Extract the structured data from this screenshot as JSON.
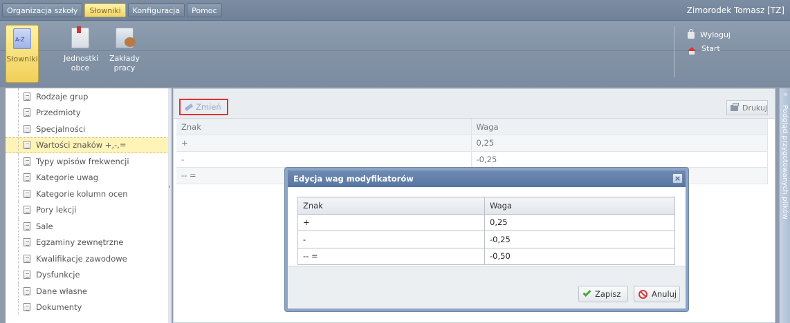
{
  "menu": {
    "items": [
      {
        "label": "Organizacja szkoły",
        "active": false
      },
      {
        "label": "Słowniki",
        "active": true
      },
      {
        "label": "Konfiguracja",
        "active": false
      },
      {
        "label": "Pomoc",
        "active": false
      }
    ],
    "user": "Zimorodek Tomasz [TZ]"
  },
  "ribbon": {
    "buttons": [
      {
        "label": "Słowniki",
        "icon": "dictionary-icon",
        "active": true
      },
      {
        "label": "Jednostki obce",
        "icon": "document-icon",
        "active": false
      },
      {
        "label": "Zakłady pracy",
        "icon": "briefcase-icon",
        "active": false
      }
    ],
    "logout": "Wyloguj",
    "start": "Start"
  },
  "sidebar": {
    "items": [
      "Rodzaje grup",
      "Przedmioty",
      "Specjalności",
      "Wartości znaków +,-,=",
      "Typy wpisów frekwencji",
      "Kategorie uwag",
      "Kategorie kolumn ocen",
      "Pory lekcji",
      "Sale",
      "Egzaminy zewnętrzne",
      "Kwalifikacje zawodowe",
      "Dysfunkcje",
      "Dane własne",
      "Dokumenty"
    ],
    "selected_index": 3
  },
  "main": {
    "toolbar": {
      "edit_label": "Zmień",
      "print_label": "Drukuj"
    },
    "columns": [
      "Znak",
      "Waga"
    ],
    "rows": [
      [
        "+",
        "0,25"
      ],
      [
        "-",
        "-0,25"
      ],
      [
        "-- =",
        ""
      ]
    ]
  },
  "right_tab": "Podgląd przygotowanych plików",
  "modal": {
    "title": "Edycja wag modyfikatorów",
    "columns": [
      "Znak",
      "Waga"
    ],
    "rows": [
      [
        "+",
        "0,25"
      ],
      [
        "-",
        "-0,25"
      ],
      [
        "-- =",
        "-0,50"
      ]
    ],
    "save_label": "Zapisz",
    "cancel_label": "Anuluj"
  },
  "colors": {
    "accent_yellow": "#f0cf58",
    "header_blue": "#5776a2",
    "highlight_red": "#e03232"
  }
}
